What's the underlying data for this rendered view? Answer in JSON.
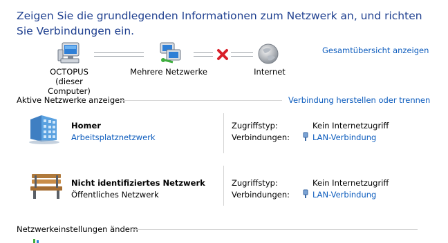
{
  "heading": "Zeigen Sie die grundlegenden Informationen zum Netzwerk an, und richten Sie Verbindungen ein.",
  "overview_link": "Gesamtübersicht anzeigen",
  "map": {
    "computer": {
      "name": "OCTOPUS",
      "sub": "(dieser Computer)"
    },
    "middle": {
      "name": "Mehrere Netzwerke"
    },
    "internet": {
      "name": "Internet"
    },
    "connection_status": "no-connection-x-icon"
  },
  "active_networks": {
    "label": "Aktive Netzwerke anzeigen",
    "connect_link": "Verbindung herstellen oder trennen",
    "access_label": "Zugriffstyp:",
    "connections_label": "Verbindungen:",
    "items": [
      {
        "name": "Homer",
        "type": "Arbeitsplatznetzwerk",
        "type_is_link": true,
        "access": "Kein Internetzugriff",
        "connection": "LAN-Verbindung",
        "icon": "work-network-icon"
      },
      {
        "name": "Nicht identifiziertes Netzwerk",
        "type": "Öffentliches Netzwerk",
        "type_is_link": false,
        "access": "Kein Internetzugriff",
        "connection": "LAN-Verbindung",
        "icon": "public-bench-icon"
      }
    ]
  },
  "settings": {
    "label": "Netzwerkeinstellungen ändern"
  },
  "colors": {
    "heading": "#1e3f8f",
    "link": "#0b5bbd",
    "error": "#d8202a"
  }
}
